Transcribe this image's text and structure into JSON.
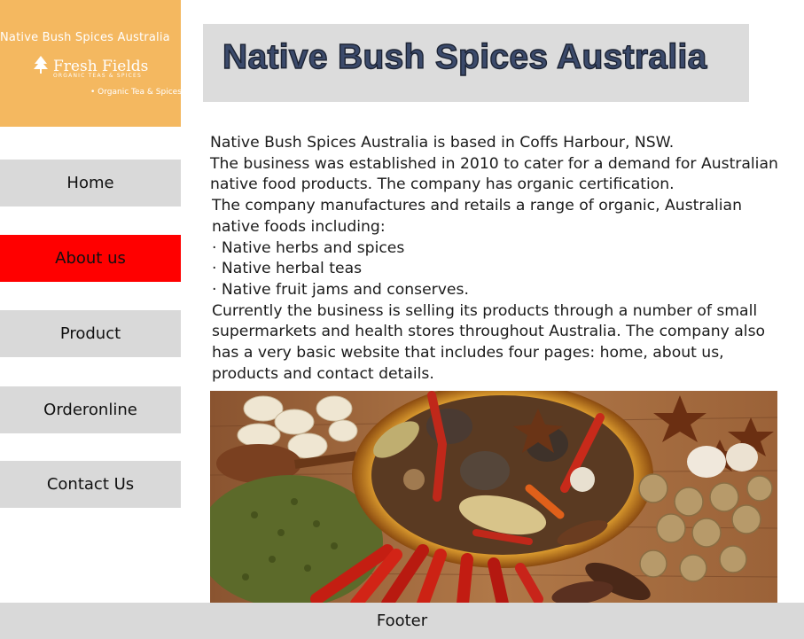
{
  "logo": {
    "brand_line": "Native Bush Spices Australia",
    "name": "Fresh Fields",
    "subtitle": "ORGANIC TEAS & SPICES",
    "tagline": "• Organic Tea & Spices",
    "icon": "tree-icon",
    "bg_color": "#f4b860"
  },
  "nav": {
    "items": [
      {
        "label": "Home",
        "active": false
      },
      {
        "label": "About us",
        "active": true
      },
      {
        "label": "Product",
        "active": false
      },
      {
        "label": "Orderonline",
        "active": false
      },
      {
        "label": "Contact Us",
        "active": false
      }
    ],
    "active_color": "#ff0000"
  },
  "header": {
    "title": "Native Bush Spices Australia"
  },
  "content": {
    "para1": "Native Bush Spices Australia is based in Coffs Harbour, NSW.",
    "para2": "The business was established in 2010 to cater for a demand for Australian native food products. The company has organic certification.",
    "para3": "The company manufactures and retails a range of organic, Australian native foods including:",
    "bullets": [
      "· Native herbs and spices",
      "· Native herbal teas",
      "· Native fruit jams and conserves."
    ],
    "para4": "Currently the business is selling its products through a number of small supermarkets and health stores throughout Australia. The company also has a very basic website that includes four pages: home, about us, products and contact details."
  },
  "footer": {
    "label": "Footer"
  }
}
